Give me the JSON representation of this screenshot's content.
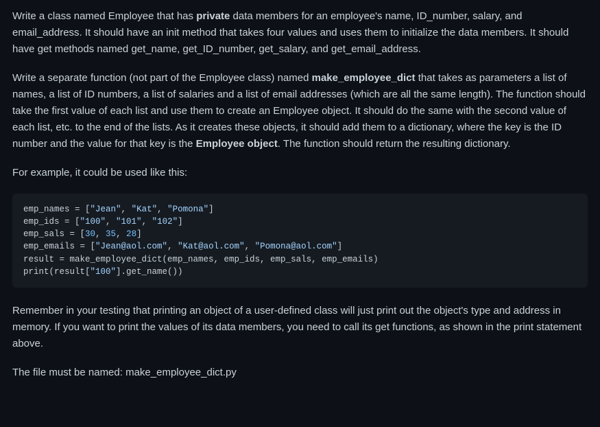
{
  "p1": {
    "t1": "Write a class named Employee that has ",
    "b1": "private",
    "t2": " data members for an employee's name, ID_number, salary, and email_address. It should have an init method that takes four values and uses them to initialize the data members. It should have get methods named get_name, get_ID_number, get_salary, and get_email_address."
  },
  "p2": {
    "t1": "Write a separate function (not part of the Employee class) named ",
    "b1": "make_employee_dict",
    "t2": " that takes as parameters a list of names, a list of ID numbers, a list of salaries and a list of email addresses (which are all the same length). The function should take the first value of each list and use them to create an Employee object. It should do the same with the second value of each list, etc. to the end of the lists. As it creates these objects, it should add them to a dictionary, where the key is the ID number and the value for that key is the ",
    "b2": "Employee object",
    "t3": ". The function should return the resulting dictionary."
  },
  "p3": "For example, it could be used like this:",
  "code": "emp_names = [\"Jean\", \"Kat\", \"Pomona\"]\nemp_ids = [\"100\", \"101\", \"102\"]\nemp_sals = [30, 35, 28]\nemp_emails = [\"Jean@aol.com\", \"Kat@aol.com\", \"Pomona@aol.com\"]\nresult = make_employee_dict(emp_names, emp_ids, emp_sals, emp_emails)\nprint(result[\"100\"].get_name())",
  "p4": "Remember in your testing that printing an object of a user-defined class will just print out the object's type and address in memory. If you want to print the values of its data members, you need to call its get functions, as shown in the print statement above.",
  "p5": "The file must be named: make_employee_dict.py"
}
